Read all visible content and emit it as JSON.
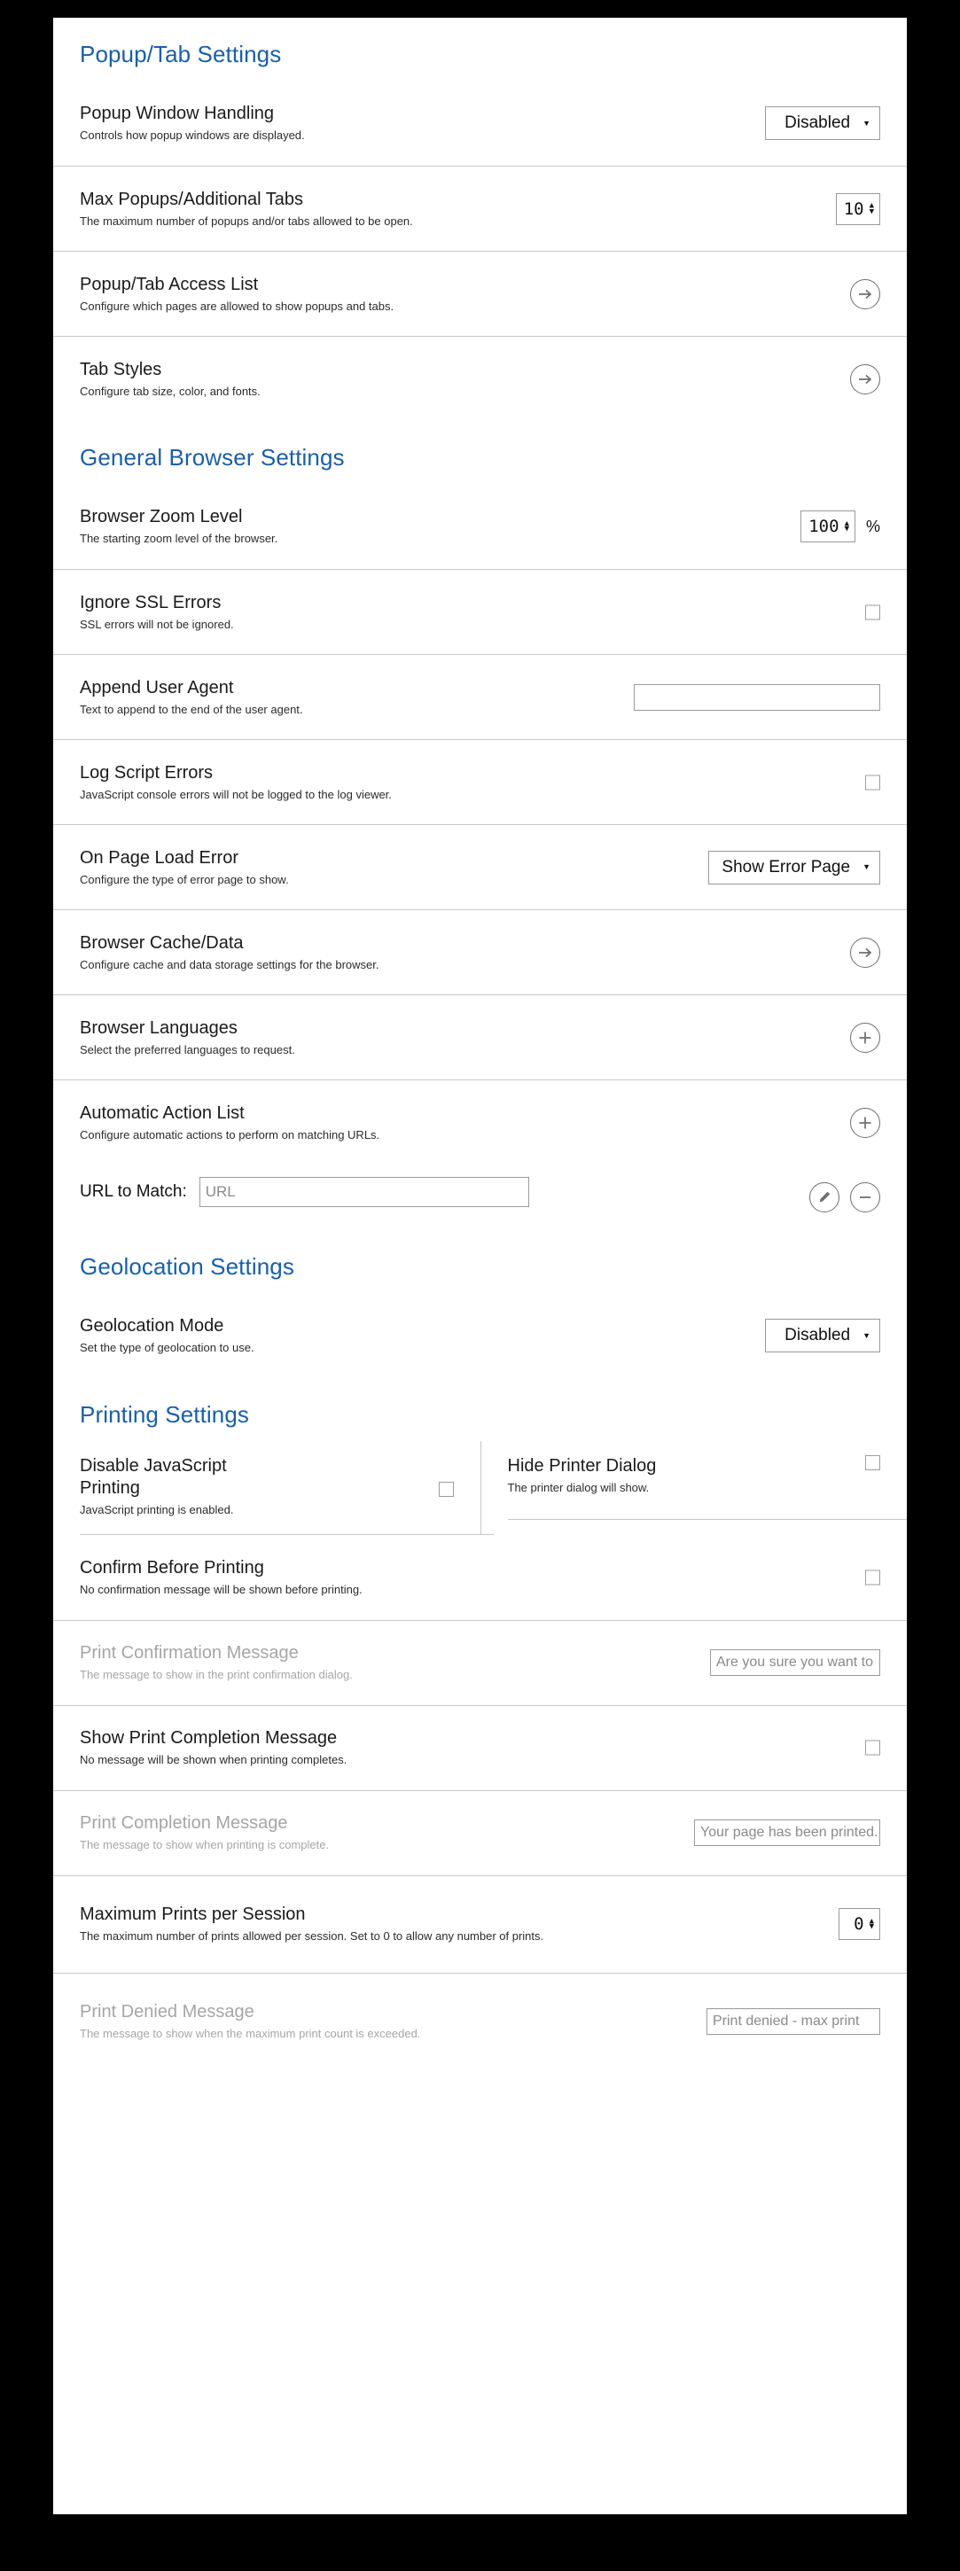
{
  "sections": [
    {
      "id": "popup-tab",
      "title": "Popup/Tab Settings",
      "rows": [
        {
          "name": "popup-window-handling",
          "title": "Popup Window Handling",
          "desc": "Controls how popup windows are displayed.",
          "control": "select",
          "value": "Disabled"
        },
        {
          "name": "max-popups-additional-tabs",
          "title": "Max Popups/Additional Tabs",
          "desc": "The maximum number of popups and/or tabs allowed to be open.",
          "control": "spinner",
          "value": "10"
        },
        {
          "name": "popup-tab-access-list",
          "title": "Popup/Tab Access List",
          "desc": "Configure which pages are allowed to show popups and tabs.",
          "control": "arrow-right"
        },
        {
          "name": "tab-styles",
          "title": "Tab Styles",
          "desc": "Configure tab size, color, and fonts.",
          "control": "arrow-right"
        }
      ]
    },
    {
      "id": "general-browser",
      "title": "General Browser Settings",
      "rows": [
        {
          "name": "browser-zoom-level",
          "title": "Browser Zoom Level",
          "desc": "The starting zoom level of the browser.",
          "control": "spinner-percent",
          "value": "100",
          "suffix": "%"
        },
        {
          "name": "ignore-ssl-errors",
          "title": "Ignore SSL Errors",
          "desc": "SSL errors will not be ignored.",
          "control": "checkbox",
          "checked": false
        },
        {
          "name": "append-user-agent",
          "title": "Append User Agent",
          "desc": "Text to append to the end of the user agent.",
          "control": "text",
          "value": "",
          "placeholder": ""
        },
        {
          "name": "log-script-errors",
          "title": "Log Script Errors",
          "desc": "JavaScript console errors will not be logged to the log viewer.",
          "control": "checkbox",
          "checked": false
        },
        {
          "name": "on-page-load-error",
          "title": "On Page Load Error",
          "desc": "Configure the type of error page to show.",
          "control": "select",
          "value": "Show Error Page"
        },
        {
          "name": "browser-cache-data",
          "title": "Browser Cache/Data",
          "desc": "Configure cache and data storage settings for the browser.",
          "control": "arrow-right"
        },
        {
          "name": "browser-languages",
          "title": "Browser Languages",
          "desc": "Select the preferred languages to request.",
          "control": "plus"
        },
        {
          "name": "automatic-action-list",
          "title": "Automatic Action List",
          "desc": "Configure automatic actions to perform on matching URLs.",
          "control": "plus"
        }
      ],
      "url_row": {
        "name": "url-to-match",
        "label": "URL to Match:",
        "value": "",
        "placeholder": "URL"
      }
    },
    {
      "id": "geolocation",
      "title": "Geolocation Settings",
      "rows": [
        {
          "name": "geolocation-mode",
          "title": "Geolocation Mode",
          "desc": "Set the type of geolocation to use.",
          "control": "select",
          "value": "Disabled"
        }
      ]
    }
  ],
  "printing": {
    "title": "Printing Settings",
    "two_col": {
      "left": {
        "name": "disable-javascript-printing",
        "title": "Disable JavaScript Printing",
        "desc": "JavaScript printing is enabled.",
        "control": "checkbox",
        "checked": false
      },
      "right": {
        "name": "hide-printer-dialog",
        "title": "Hide Printer Dialog",
        "desc": "The printer dialog will show.",
        "control": "checkbox",
        "checked": false
      }
    },
    "rows": [
      {
        "name": "confirm-before-printing",
        "title": "Confirm Before Printing",
        "desc": "No confirmation message will be shown before printing.",
        "control": "checkbox",
        "checked": false,
        "disabled": false
      },
      {
        "name": "print-confirmation-message",
        "title": "Print Confirmation Message",
        "desc": "The message to show in the print confirmation dialog.",
        "control": "text",
        "value": "Are you sure you want to",
        "disabled": true
      },
      {
        "name": "show-print-completion-message",
        "title": "Show Print Completion Message",
        "desc": "No message will be shown when printing completes.",
        "control": "checkbox",
        "checked": false,
        "disabled": false
      },
      {
        "name": "print-completion-message",
        "title": "Print Completion Message",
        "desc": "The message to show when printing is complete.",
        "control": "text",
        "value": "Your page has been printed.",
        "disabled": true
      },
      {
        "name": "maximum-prints-per-session",
        "title": "Maximum Prints per Session",
        "desc": "The maximum number of prints allowed per session.  Set to 0 to allow any number of prints.",
        "control": "spinner",
        "value": "0",
        "disabled": false
      },
      {
        "name": "print-denied-message",
        "title": "Print Denied Message",
        "desc": "The message to show when the maximum print count is exceeded.",
        "control": "text",
        "value": "Print denied - max print",
        "disabled": true
      }
    ]
  },
  "icons": {
    "arrow_right": "arrow-right-circle-icon",
    "plus": "plus-circle-icon",
    "minus": "minus-circle-icon",
    "edit": "pencil-circle-icon",
    "caret_down": "chevron-down-icon",
    "spinner_up": "caret-up-icon",
    "spinner_down": "caret-down-icon"
  },
  "colors": {
    "accent": "#1b5fa5",
    "text": "#1a1a1a",
    "muted": "#a6a6a6",
    "divider": "#c8c8c8",
    "border": "#9a9a9a",
    "icon_stroke": "#6e6e6e",
    "page_bg": "#ffffff",
    "outside_bg": "#000000"
  }
}
